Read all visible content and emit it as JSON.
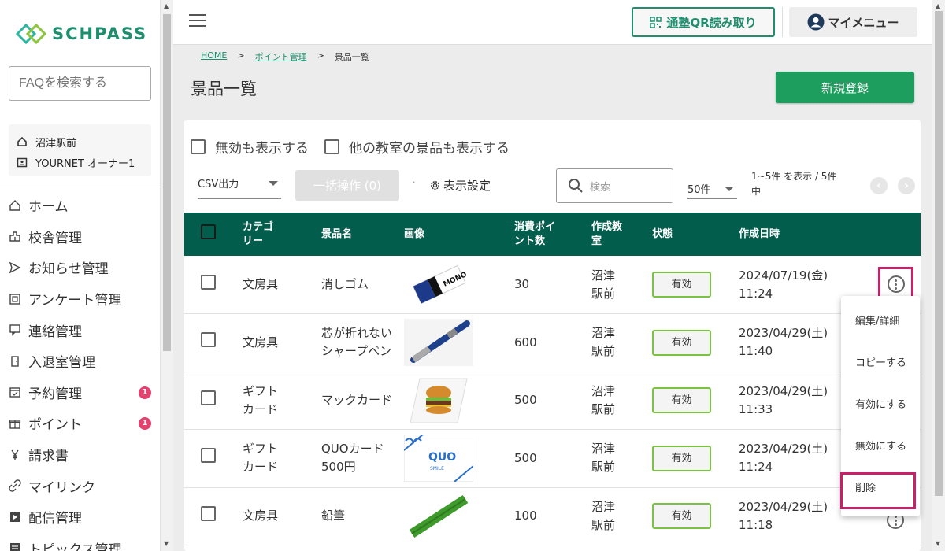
{
  "brand": {
    "name": "SCHPASS"
  },
  "faq_placeholder": "FAQを検索する",
  "school": {
    "name": "沼津駅前",
    "user": "YOURNET オーナー1"
  },
  "nav": [
    {
      "label": "ホーム",
      "icon": "home-icon"
    },
    {
      "label": "校舎管理",
      "icon": "building-icon"
    },
    {
      "label": "お知らせ管理",
      "icon": "send-icon"
    },
    {
      "label": "アンケート管理",
      "icon": "survey-icon"
    },
    {
      "label": "連絡管理",
      "icon": "chat-icon"
    },
    {
      "label": "入退室管理",
      "icon": "door-icon"
    },
    {
      "label": "予約管理",
      "icon": "calendar-icon",
      "badge": "1"
    },
    {
      "label": "ポイント",
      "icon": "gift-icon",
      "badge": "1"
    },
    {
      "label": "請求書",
      "icon": "yen-icon"
    },
    {
      "label": "マイリンク",
      "icon": "link-icon"
    },
    {
      "label": "配信管理",
      "icon": "video-icon"
    },
    {
      "label": "トピックス管理",
      "icon": "topics-icon"
    }
  ],
  "header": {
    "qr_button": "通塾QR読み取り",
    "my_menu": "マイメニュー"
  },
  "breadcrumb": {
    "home": "HOME",
    "points": "ポイント管理",
    "current": "景品一覧",
    "sep": ">"
  },
  "page_title": "景品一覧",
  "new_button": "新規登録",
  "filters": {
    "show_invalid": "無効も表示する",
    "show_other": "他の教室の景品も表示する"
  },
  "toolbar": {
    "csv": "CSV出力",
    "bulk": "一括操作 (0)",
    "dot": "·",
    "display": "表示設定",
    "search_placeholder": "検索",
    "per_page": "50件",
    "count": "1~5件 を表示 / 5件中"
  },
  "table": {
    "headers": {
      "category": "カテゴリー",
      "name": "景品名",
      "image": "画像",
      "points": "消費ポイント数",
      "school": "作成教室",
      "status": "状態",
      "created": "作成日時"
    },
    "rows": [
      {
        "category": "文房具",
        "name": "消しゴム",
        "image": "eraser",
        "points": "30",
        "school": "沼津駅前",
        "status": "有効",
        "date": "2024/07/19(金)",
        "time": "11:24"
      },
      {
        "category": "文房具",
        "name": "芯が折れないシャープペン",
        "image": "pen",
        "points": "600",
        "school": "沼津駅前",
        "status": "有効",
        "date": "2023/04/29(土)",
        "time": "11:40"
      },
      {
        "category": "ギフトカード",
        "name": "マックカード",
        "image": "burger",
        "points": "500",
        "school": "沼津駅前",
        "status": "有効",
        "date": "2023/04/29(土)",
        "time": "11:33"
      },
      {
        "category": "ギフトカード",
        "name": "QUOカード500円",
        "image": "quocard",
        "points": "500",
        "school": "沼津駅前",
        "status": "有効",
        "date": "2023/04/29(土)",
        "time": "11:24"
      },
      {
        "category": "文房具",
        "name": "鉛筆",
        "image": "pencil",
        "points": "100",
        "school": "沼津駅前",
        "status": "有効",
        "date": "2023/04/29(土)",
        "time": "11:18"
      }
    ]
  },
  "context_menu": [
    "編集/詳細",
    "コピーする",
    "有効にする",
    "無効にする",
    "削除"
  ],
  "colors": {
    "brand": "#1e8e6e",
    "header": "#035d4d",
    "highlight": "#cc1f6a",
    "badge": "#e5416e",
    "status_border": "#7bc142"
  }
}
